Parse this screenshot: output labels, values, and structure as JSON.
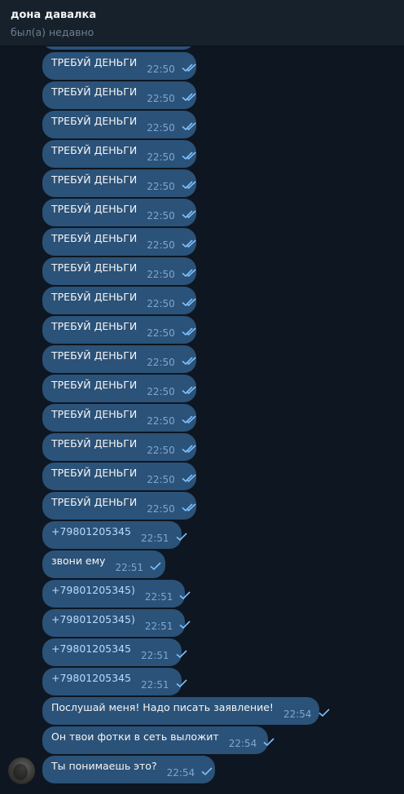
{
  "header": {
    "title": "дона давалка",
    "status": "был(а) недавно"
  },
  "messages": [
    {
      "text": "ТРЕБУЙ ДЕНЬГИ",
      "time": "22:50",
      "read": true
    },
    {
      "text": "ТРЕБУЙ ДЕНЬГИ",
      "time": "22:50",
      "read": true
    },
    {
      "text": "ТРЕБУЙ ДЕНЬГИ",
      "time": "22:50",
      "read": true
    },
    {
      "text": "ТРЕБУЙ ДЕНЬГИ",
      "time": "22:50",
      "read": true
    },
    {
      "text": "ТРЕБУЙ ДЕНЬГИ",
      "time": "22:50",
      "read": true
    },
    {
      "text": "ТРЕБУЙ ДЕНЬГИ",
      "time": "22:50",
      "read": true
    },
    {
      "text": "ТРЕБУЙ ДЕНЬГИ",
      "time": "22:50",
      "read": true
    },
    {
      "text": "ТРЕБУЙ ДЕНЬГИ",
      "time": "22:50",
      "read": true
    },
    {
      "text": "ТРЕБУЙ ДЕНЬГИ",
      "time": "22:50",
      "read": true
    },
    {
      "text": "ТРЕБУЙ ДЕНЬГИ",
      "time": "22:50",
      "read": true
    },
    {
      "text": "ТРЕБУЙ ДЕНЬГИ",
      "time": "22:50",
      "read": true
    },
    {
      "text": "ТРЕБУЙ ДЕНЬГИ",
      "time": "22:50",
      "read": true
    },
    {
      "text": "ТРЕБУЙ ДЕНЬГИ",
      "time": "22:50",
      "read": true
    },
    {
      "text": "ТРЕБУЙ ДЕНЬГИ",
      "time": "22:50",
      "read": true
    },
    {
      "text": "ТРЕБУЙ ДЕНЬГИ",
      "time": "22:50",
      "read": true
    },
    {
      "text": "ТРЕБУЙ ДЕНЬГИ",
      "time": "22:50",
      "read": true
    },
    {
      "text": "+79801205345",
      "time": "22:51",
      "read": false,
      "link": true
    },
    {
      "text": "звони ему",
      "time": "22:51",
      "read": false
    },
    {
      "text": "+79801205345)",
      "time": "22:51",
      "read": false,
      "link": true
    },
    {
      "text": "+79801205345)",
      "time": "22:51",
      "read": false,
      "link": true
    },
    {
      "text": "+79801205345",
      "time": "22:51",
      "read": false,
      "link": true
    },
    {
      "text": "+79801205345",
      "time": "22:51",
      "read": false,
      "link": true
    },
    {
      "text": "Послушай меня! Надо писать заявление!",
      "time": "22:54",
      "read": false
    },
    {
      "text": "Он твои фотки в сеть выложит",
      "time": "22:54",
      "read": false
    },
    {
      "text": "Ты понимаешь это?",
      "time": "22:54",
      "read": false
    }
  ],
  "colors": {
    "background": "#0e1621",
    "header": "#17212b",
    "bubble": "#2b5278",
    "time": "#7da8d3",
    "link": "#b9dcff"
  }
}
